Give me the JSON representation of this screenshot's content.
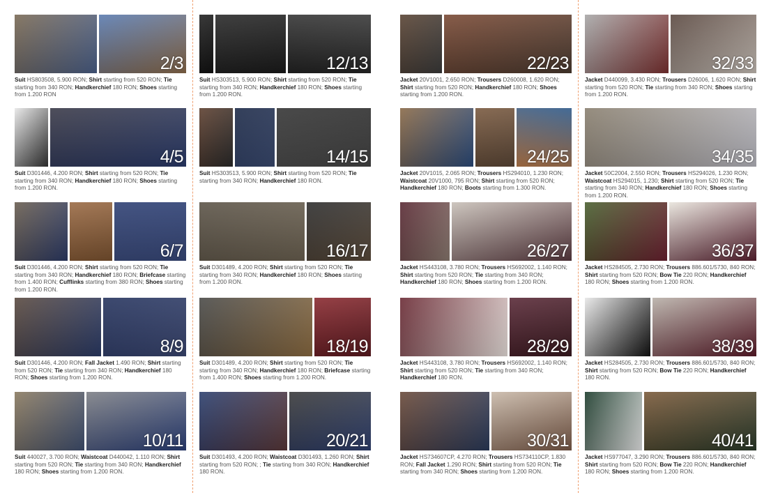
{
  "colors": {
    "divider": "#f0a070",
    "caption_text": "#555555",
    "caption_bold": "#1f1f1f"
  },
  "cells": [
    {
      "pages": "2/3",
      "caption": [
        {
          "b": "Suit",
          "t": " HS803508, 5.900 RON; "
        },
        {
          "b": "Shirt",
          "t": " starting from 520 RON; "
        },
        {
          "b": "Tie",
          "t": " starting from 340 RON; "
        },
        {
          "b": "Handkerchief",
          "t": " 180 RON; "
        },
        {
          "b": "Shoes",
          "t": " starting from 1.200 RON"
        }
      ]
    },
    {
      "pages": "4/5",
      "caption": [
        {
          "b": "Suit",
          "t": " D301446, 4.200 RON; "
        },
        {
          "b": "Shirt",
          "t": " starting from 520 RON; "
        },
        {
          "b": "Tie",
          "t": " starting from 340 RON; "
        },
        {
          "b": "Handkerchief",
          "t": " 180 RON; "
        },
        {
          "b": "Shoes",
          "t": " starting from 1.200 RON."
        }
      ]
    },
    {
      "pages": "6/7",
      "caption": [
        {
          "b": "Suit",
          "t": " D301446, 4.200 RON; "
        },
        {
          "b": "Shirt",
          "t": " starting from 520 RON; "
        },
        {
          "b": "Tie",
          "t": " starting from 340 RON; "
        },
        {
          "b": "Handkerchief",
          "t": " 180 RON; "
        },
        {
          "b": "Briefcase",
          "t": " starting from 1.400 RON; "
        },
        {
          "b": "Cufflinks",
          "t": " starting from 380 RON; "
        },
        {
          "b": "Shoes",
          "t": " starting from 1.200 RON."
        }
      ]
    },
    {
      "pages": "8/9",
      "caption": [
        {
          "b": "Suit",
          "t": " D301446, 4.200 RON; "
        },
        {
          "b": "Fall Jacket",
          "t": " 1.490 RON; "
        },
        {
          "b": "Shirt",
          "t": " starting from 520 RON; "
        },
        {
          "b": "Tie",
          "t": " starting from 340 RON; "
        },
        {
          "b": "Handkerchief",
          "t": " 180 RON; "
        },
        {
          "b": "Shoes",
          "t": " starting from 1.200 RON."
        }
      ]
    },
    {
      "pages": "10/11",
      "caption": [
        {
          "b": "Suit",
          "t": " 440027, 3.700 RON; "
        },
        {
          "b": "Waistcoat",
          "t": " D440042, 1.110 RON; "
        },
        {
          "b": "Shirt",
          "t": " starting from 520 RON; "
        },
        {
          "b": "Tie",
          "t": " starting from 340 RON; "
        },
        {
          "b": "Handkerchief",
          "t": " 180 RON; "
        },
        {
          "b": "Shoes",
          "t": " starting from 1.200 RON."
        }
      ]
    },
    {
      "pages": "12/13",
      "caption": [
        {
          "b": "Suit",
          "t": " HS303513, 5.900 RON; "
        },
        {
          "b": "Shirt",
          "t": " starting from 520 RON; "
        },
        {
          "b": "Tie",
          "t": " starting from 340 RON; "
        },
        {
          "b": "Handkerchief",
          "t": " 180 RON; "
        },
        {
          "b": "Shoes",
          "t": " starting from 1.200 RON."
        }
      ]
    },
    {
      "pages": "14/15",
      "caption": [
        {
          "b": "Suit",
          "t": " HS303513, 5.900 RON; "
        },
        {
          "b": "Shirt",
          "t": " starting from 520 RON; "
        },
        {
          "b": "Tie",
          "t": " starting from 340 RON; "
        },
        {
          "b": "Handkerchief",
          "t": " 180 RON."
        }
      ]
    },
    {
      "pages": "16/17",
      "caption": [
        {
          "b": "Suit",
          "t": " D301489, 4.200 RON; "
        },
        {
          "b": "Shirt",
          "t": " starting from 520 RON; "
        },
        {
          "b": "Tie",
          "t": " starting from 340 RON; "
        },
        {
          "b": "Handkerchief",
          "t": " 180 RON; "
        },
        {
          "b": "Shoes",
          "t": " starting from 1.200 RON."
        }
      ]
    },
    {
      "pages": "18/19",
      "caption": [
        {
          "b": "Suit",
          "t": " D301489, 4.200 RON; "
        },
        {
          "b": "Shirt",
          "t": " starting from 520 RON; "
        },
        {
          "b": "Tie",
          "t": " starting from 340 RON; "
        },
        {
          "b": "Handkerchief",
          "t": " 180 RON; "
        },
        {
          "b": "Briefcase",
          "t": " starting from 1.400 RON; "
        },
        {
          "b": "Shoes",
          "t": " starting from 1.200 RON."
        }
      ]
    },
    {
      "pages": "20/21",
      "caption": [
        {
          "b": "Suit",
          "t": " D301493, 4.200 RON; "
        },
        {
          "b": "Waistcoat",
          "t": " D301493, 1.260 RON; "
        },
        {
          "b": "Shirt",
          "t": " starting from 520 RON; ; "
        },
        {
          "b": "Tie",
          "t": " starting from 340 RON; "
        },
        {
          "b": "Handkerchief",
          "t": " 180 RON."
        }
      ]
    },
    {
      "pages": "22/23",
      "caption": [
        {
          "b": "Jacket",
          "t": " 20V1001, 2.650 RON; "
        },
        {
          "b": "Trousers",
          "t": " D260008, 1.620 RON; "
        },
        {
          "b": "Shirt",
          "t": " starting from 520 RON; "
        },
        {
          "b": "Handkerchief",
          "t": " 180 RON; "
        },
        {
          "b": "Shoes",
          "t": " starting from 1.200 RON."
        }
      ]
    },
    {
      "pages": "24/25",
      "caption": [
        {
          "b": "Jacket",
          "t": " 20V1015, 2.065 RON; "
        },
        {
          "b": "Trousers",
          "t": " HS294010, 1.230 RON; "
        },
        {
          "b": "Waistcoat",
          "t": " 20V1000, 795 RON; "
        },
        {
          "b": "Shirt",
          "t": " starting from 520 RON; "
        },
        {
          "b": "Handkerchief",
          "t": " 180 RON; "
        },
        {
          "b": "Boots",
          "t": " starting from 1.300 RON."
        }
      ]
    },
    {
      "pages": "26/27",
      "caption": [
        {
          "b": "Jacket",
          "t": " HS443108, 3.780 RON; "
        },
        {
          "b": "Trousers",
          "t": " HS692002, 1.140 RON; "
        },
        {
          "b": "Shirt",
          "t": " starting from 520 RON; "
        },
        {
          "b": "Tie",
          "t": " starting from 340 RON; "
        },
        {
          "b": "Handkerchief",
          "t": " 180 RON; "
        },
        {
          "b": "Shoes",
          "t": " starting from 1.200 RON."
        }
      ]
    },
    {
      "pages": "28/29",
      "caption": [
        {
          "b": "Jacket",
          "t": " HS443108, 3.780 RON; "
        },
        {
          "b": "Trousers",
          "t": " HS692002, 1.140 RON; "
        },
        {
          "b": "Shirt",
          "t": " starting from 520 RON; "
        },
        {
          "b": "Tie",
          "t": " starting from 340 RON; "
        },
        {
          "b": "Handkerchief",
          "t": " 180 RON."
        }
      ]
    },
    {
      "pages": "30/31",
      "caption": [
        {
          "b": "Jacket",
          "t": " HS734607CP, 4.270 RON; "
        },
        {
          "b": "Trousers",
          "t": " HS734110CP, 1.830 RON; "
        },
        {
          "b": "Fall Jacket",
          "t": " 1.290 RON; "
        },
        {
          "b": "Shirt",
          "t": " starting from 520 RON; "
        },
        {
          "b": "Tie",
          "t": " starting from 340 RON; "
        },
        {
          "b": "Shoes",
          "t": " starting from 1.200 RON."
        }
      ]
    },
    {
      "pages": "32/33",
      "caption": [
        {
          "b": "Jacket",
          "t": " D440099, 3.430 RON; "
        },
        {
          "b": "Trousers",
          "t": " D26006, 1.620 RON; "
        },
        {
          "b": "Shirt",
          "t": " starting from 520 RON; "
        },
        {
          "b": "Tie",
          "t": " starting from 340 RON; "
        },
        {
          "b": "Shoes",
          "t": " starting from 1.200 RON."
        }
      ]
    },
    {
      "pages": "34/35",
      "caption": [
        {
          "b": "Jacket",
          "t": " 50C2004, 2.550 RON; "
        },
        {
          "b": "Trousers",
          "t": " HS294026, 1.230 RON; "
        },
        {
          "b": "Waistcoat",
          "t": " HS294015, 1.230; "
        },
        {
          "b": "Shirt",
          "t": " starting from 520 RON; "
        },
        {
          "b": "Tie",
          "t": " starting from 340 RON; "
        },
        {
          "b": "Handkerchief",
          "t": " 180 RON; "
        },
        {
          "b": "Shoes",
          "t": " starting from 1.200 RON."
        }
      ]
    },
    {
      "pages": "36/37",
      "caption": [
        {
          "b": "Jacket",
          "t": " HS284505, 2.730 RON; "
        },
        {
          "b": "Trousers",
          "t": " 886.601/5730, 840 RON; "
        },
        {
          "b": "Shirt",
          "t": " starting from 520 RON; "
        },
        {
          "b": "Bow Tie",
          "t": " 220 RON; "
        },
        {
          "b": "Handkerchief",
          "t": " 180 RON; "
        },
        {
          "b": "Shoes",
          "t": " starting from 1.200 RON."
        }
      ]
    },
    {
      "pages": "38/39",
      "caption": [
        {
          "b": "Jacket",
          "t": " HS284505, 2.730 RON; "
        },
        {
          "b": "Trousers",
          "t": " 886.601/5730, 840 RON; "
        },
        {
          "b": "Shirt",
          "t": " starting from 520 RON; "
        },
        {
          "b": "Bow Tie",
          "t": " 220 RON; "
        },
        {
          "b": "Handkerchief",
          "t": " 180 RON."
        }
      ]
    },
    {
      "pages": "40/41",
      "caption": [
        {
          "b": "Jacket",
          "t": " HS977047, 3.290 RON; "
        },
        {
          "b": "Trousers",
          "t": " 886.601/5730, 840 RON; "
        },
        {
          "b": "Shirt",
          "t": " starting from 520 RON; "
        },
        {
          "b": "Bow Tie",
          "t": " 220 RON; "
        },
        {
          "b": "Handkerchief",
          "t": " 180 RON; "
        },
        {
          "b": "Shoes",
          "t": " starting from 1.200 RON."
        }
      ]
    }
  ]
}
